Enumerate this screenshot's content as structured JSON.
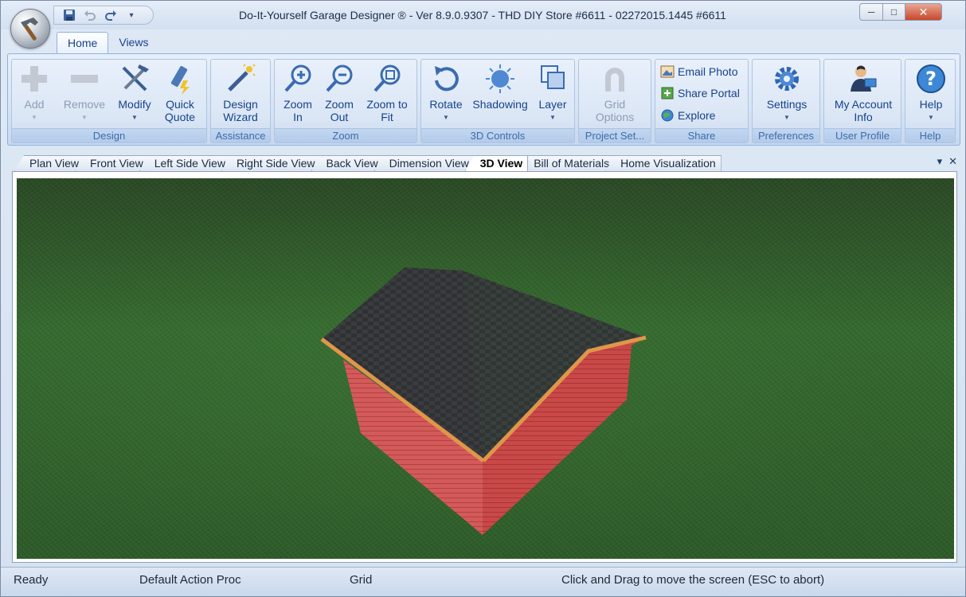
{
  "window": {
    "title": "Do-It-Yourself Garage Designer ® - Ver 8.9.0.9307 - THD DIY Store #6611 - 02272015.1445 #6611",
    "controls": {
      "minimize": "─",
      "maximize": "□",
      "close": "✕"
    }
  },
  "quick_access": {
    "save_icon": "save-icon",
    "undo_icon": "undo-icon",
    "redo_icon": "redo-icon",
    "customize_icon": "dropdown-icon"
  },
  "ribbon_tabs": [
    {
      "label": "Home",
      "active": true
    },
    {
      "label": "Views",
      "active": false
    }
  ],
  "ribbon": {
    "design": {
      "label": "Design",
      "add": {
        "line1": "Add",
        "line2": "",
        "enabled": false
      },
      "remove": {
        "line1": "Remove",
        "line2": "",
        "enabled": false
      },
      "modify": {
        "line1": "Modify",
        "line2": ""
      },
      "quick_quote": {
        "line1": "Quick",
        "line2": "Quote"
      }
    },
    "assistance": {
      "label": "Assistance",
      "design_wizard": {
        "line1": "Design",
        "line2": "Wizard"
      }
    },
    "zoom": {
      "label": "Zoom",
      "zoom_in": {
        "line1": "Zoom",
        "line2": "In"
      },
      "zoom_out": {
        "line1": "Zoom",
        "line2": "Out"
      },
      "zoom_fit": {
        "line1": "Zoom to",
        "line2": "Fit"
      }
    },
    "controls3d": {
      "label": "3D Controls",
      "rotate": {
        "line1": "Rotate"
      },
      "shadowing": {
        "line1": "Shadowing"
      },
      "layer": {
        "line1": "Layer"
      }
    },
    "project": {
      "label": "Project Set...",
      "grid_options": {
        "line1": "Grid",
        "line2": "Options",
        "enabled": false
      }
    },
    "share": {
      "label": "Share",
      "email_photo": "Email Photo",
      "share_portal": "Share Portal",
      "explore": "Explore"
    },
    "preferences": {
      "label": "Preferences",
      "settings": {
        "line1": "Settings"
      }
    },
    "user_profile": {
      "label": "User Profile",
      "account": {
        "line1": "My Account",
        "line2": "Info"
      }
    },
    "help": {
      "label": "Help",
      "help": {
        "line1": "Help"
      }
    }
  },
  "view_tabs": [
    {
      "label": "Plan View",
      "active": false
    },
    {
      "label": "Front View",
      "active": false
    },
    {
      "label": "Left Side View",
      "active": false
    },
    {
      "label": "Right Side View",
      "active": false
    },
    {
      "label": "Back View",
      "active": false
    },
    {
      "label": "Dimension View",
      "active": false
    },
    {
      "label": "3D View",
      "active": true
    },
    {
      "label": "Bill of Materials",
      "active": false
    },
    {
      "label": "Home Visualization",
      "active": false
    }
  ],
  "tab_controls": {
    "dropdown": "▾",
    "close": "✕"
  },
  "scene": {
    "roof_color": "#2f3133",
    "wall_color": "#c94848",
    "trim_color": "#e0964a",
    "ground_color": "#2f5a2a"
  },
  "status": {
    "state": "Ready",
    "action": "Default Action Proc",
    "grid": "Grid",
    "hint": "Click and Drag to move the screen  (ESC to abort)"
  }
}
